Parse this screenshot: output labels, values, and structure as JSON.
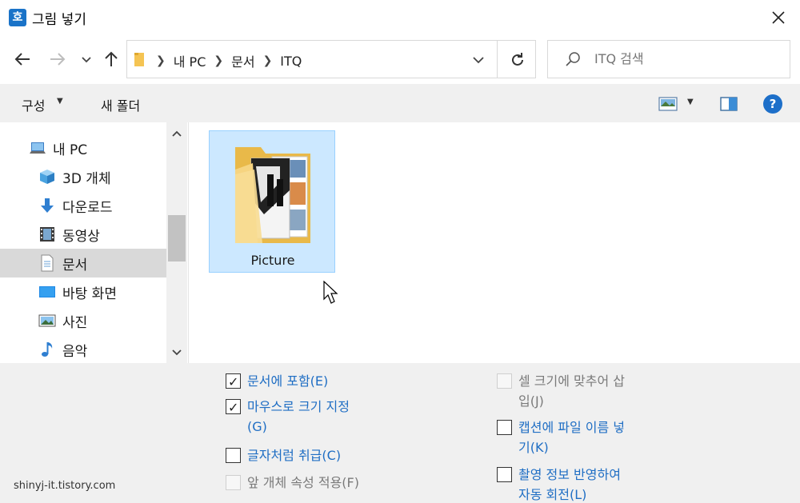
{
  "window": {
    "app_icon_glyph": "호",
    "title": "그림 넣기"
  },
  "nav": {
    "breadcrumbs": [
      "내 PC",
      "문서",
      "ITQ"
    ],
    "search_placeholder": "ITQ 검색"
  },
  "toolbar": {
    "organize_label": "구성",
    "new_folder_label": "새 폴더",
    "help_glyph": "?"
  },
  "sidebar": {
    "items": [
      {
        "label": "내 PC",
        "icon": "computer-icon"
      },
      {
        "label": "3D 개체",
        "icon": "cube-3d-icon"
      },
      {
        "label": "다운로드",
        "icon": "download-arrow-icon"
      },
      {
        "label": "동영상",
        "icon": "film-icon"
      },
      {
        "label": "문서",
        "icon": "document-icon",
        "selected": true
      },
      {
        "label": "바탕 화면",
        "icon": "desktop-icon"
      },
      {
        "label": "사진",
        "icon": "picture-icon"
      },
      {
        "label": "음악",
        "icon": "music-note-icon"
      }
    ]
  },
  "files": [
    {
      "name": "Picture",
      "type": "folder",
      "selected": true
    }
  ],
  "options": {
    "include_in_doc": {
      "label": "문서에 포함(E)",
      "checked": true,
      "enabled": true
    },
    "mouse_size": {
      "line1": "마우스로 크기 지정",
      "line2": "(G)",
      "checked": true,
      "enabled": true
    },
    "treat_as_char": {
      "label": "글자처럼 취급(C)",
      "checked": false,
      "enabled": true
    },
    "front_obj_prop": {
      "label": "앞 개체 속성 적용(F)",
      "checked": false,
      "enabled": false
    },
    "fit_cell": {
      "line1": "셀 크기에 맞추어 삽",
      "line2": "입(J)",
      "checked": false,
      "enabled": false
    },
    "caption_filename": {
      "line1": "캡션에 파일 이름 넣",
      "line2": "기(K)",
      "checked": false,
      "enabled": true
    },
    "auto_rotate": {
      "line1": "촬영 정보 반영하여",
      "line2": "자동 회전(L)",
      "checked": false,
      "enabled": true
    }
  },
  "watermark": "shinyj-it.tistory.com",
  "colors": {
    "accent": "#1f6ec4",
    "selection": "#cce8ff",
    "panel": "#f0f0f0"
  }
}
